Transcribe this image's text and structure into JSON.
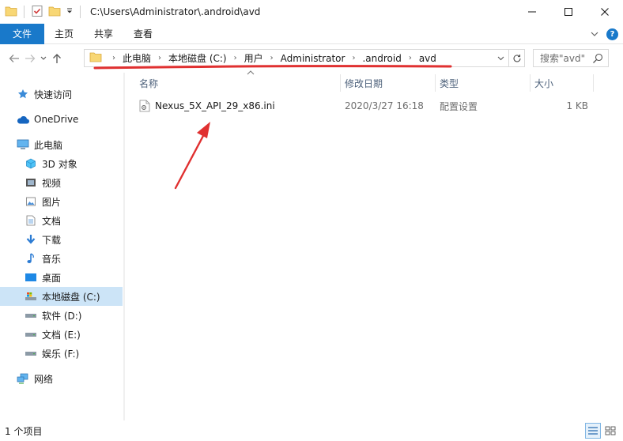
{
  "window": {
    "title": "C:\\Users\\Administrator\\.android\\avd"
  },
  "ribbon": {
    "tabs": [
      "文件",
      "主页",
      "共享",
      "查看"
    ]
  },
  "address": {
    "crumbs": [
      "此电脑",
      "本地磁盘 (C:)",
      "用户",
      "Administrator",
      ".android",
      "avd"
    ]
  },
  "search": {
    "placeholder": "搜索\"avd\""
  },
  "sidebar": {
    "items": [
      {
        "label": "快速访问",
        "icon": "star-icon"
      },
      {
        "label": "OneDrive",
        "icon": "cloud-icon"
      },
      {
        "label": "此电脑",
        "icon": "computer-icon"
      },
      {
        "label": "3D 对象",
        "icon": "cube-icon"
      },
      {
        "label": "视频",
        "icon": "video-icon"
      },
      {
        "label": "图片",
        "icon": "picture-icon"
      },
      {
        "label": "文档",
        "icon": "document-icon"
      },
      {
        "label": "下载",
        "icon": "download-icon"
      },
      {
        "label": "音乐",
        "icon": "music-icon"
      },
      {
        "label": "桌面",
        "icon": "desktop-icon"
      },
      {
        "label": "本地磁盘 (C:)",
        "icon": "system-drive-icon"
      },
      {
        "label": "软件 (D:)",
        "icon": "drive-icon"
      },
      {
        "label": "文档 (E:)",
        "icon": "drive-icon"
      },
      {
        "label": "娱乐 (F:)",
        "icon": "drive-icon"
      },
      {
        "label": "网络",
        "icon": "network-icon"
      }
    ],
    "selected": "本地磁盘 (C:)"
  },
  "columns": {
    "name": "名称",
    "modified": "修改日期",
    "type": "类型",
    "size": "大小"
  },
  "files": [
    {
      "name": "Nexus_5X_API_29_x86.ini",
      "modified": "2020/3/27 16:18",
      "type": "配置设置",
      "size": "1 KB"
    }
  ],
  "status": {
    "count": "1 个项目"
  },
  "colors": {
    "accent": "#1979ca",
    "annotation": "#e03030",
    "selection": "#cce4f7"
  }
}
